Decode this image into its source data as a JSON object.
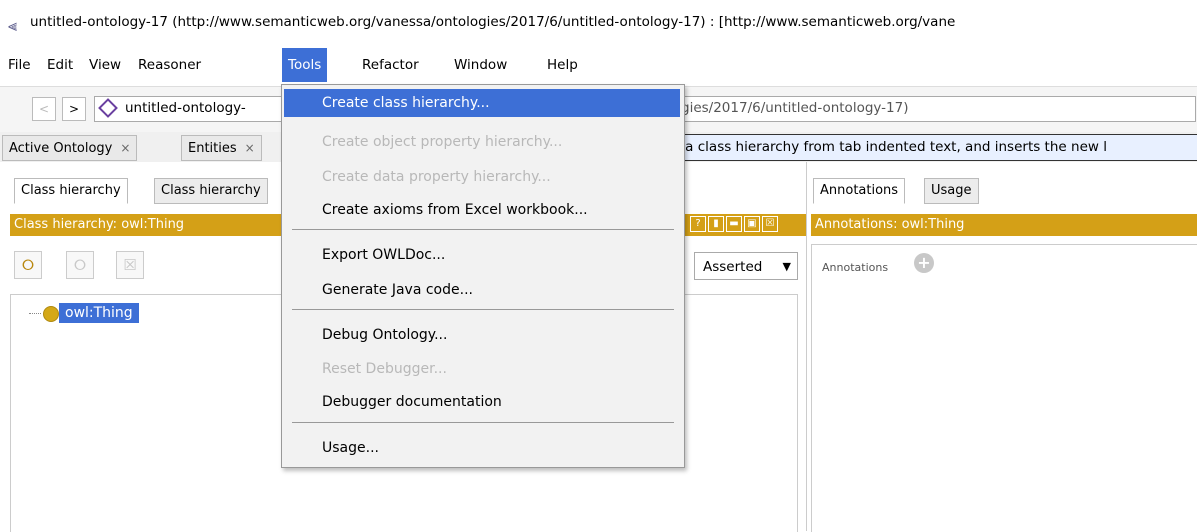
{
  "window": {
    "title": "untitled-ontology-17 (http://www.semanticweb.org/vanessa/ontologies/2017/6/untitled-ontology-17)  : [http://www.semanticweb.org/vane"
  },
  "menubar": {
    "items": [
      "File",
      "Edit",
      "View",
      "Reasoner",
      "Tools",
      "Refactor",
      "Window",
      "Help"
    ],
    "active": "Tools"
  },
  "navbar": {
    "back": "<",
    "forward": ">",
    "ontology_name": "untitled-ontology-",
    "ontology_iri": "gies/2017/6/untitled-ontology-17)"
  },
  "tabs": {
    "active_ontology": "Active Ontology",
    "entities": "Entities",
    "close": "×"
  },
  "tooltip": "Creates a class hierarchy from tab indented text, and inserts the new l",
  "left_panel": {
    "subtabs": [
      "Class hierarchy",
      "Class hierarchy"
    ],
    "header": "Class hierarchy: owl:Thing",
    "controls": [
      "?",
      "▮",
      "▬",
      "▣",
      "☒"
    ],
    "toolbar": {
      "add_subclass": "add-subclass",
      "add_sibling": "add-sibling",
      "delete": "delete"
    },
    "asserted": "Asserted",
    "tree_root": "owl:Thing"
  },
  "right_panel": {
    "subtabs": [
      "Annotations",
      "Usage"
    ],
    "header": "Annotations: owl:Thing",
    "annotations_label": "Annotations",
    "add_symbol": "+"
  },
  "tools_menu": {
    "items": [
      {
        "label": "Create class hierarchy...",
        "state": "highlighted"
      },
      {
        "label": "Create object property hierarchy...",
        "state": "disabled"
      },
      {
        "label": "Create data property hierarchy...",
        "state": "disabled"
      },
      {
        "label": "Create axioms from Excel workbook...",
        "state": "enabled"
      },
      {
        "label": "Export OWLDoc...",
        "state": "enabled"
      },
      {
        "label": "Generate Java code...",
        "state": "enabled"
      },
      {
        "label": "Debug Ontology...",
        "state": "enabled"
      },
      {
        "label": "Reset Debugger...",
        "state": "disabled"
      },
      {
        "label": "Debugger documentation",
        "state": "enabled"
      },
      {
        "label": "Usage...",
        "state": "enabled"
      }
    ]
  },
  "colors": {
    "accent": "#3d6fd6",
    "header_bar": "#d4a017",
    "tooltip_bg": "#e8f0ff"
  }
}
